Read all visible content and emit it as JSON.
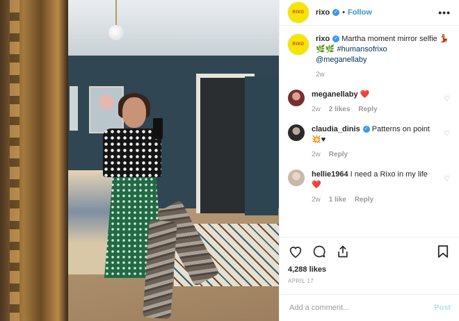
{
  "header": {
    "avatar_text": "RIXO",
    "username": "rixo",
    "verified_mark": "✓",
    "separator": "•",
    "follow_label": "Follow",
    "more_label": "•••"
  },
  "caption": {
    "username": "rixo",
    "text": "Martha moment mirror selfie",
    "emojis": "💃🌿🌿",
    "hashtag": "#humansofrixo",
    "mention": "@meganellaby",
    "time": "2w"
  },
  "comments": [
    {
      "username": "meganellaby",
      "text": "",
      "emoji": "❤️",
      "time": "2w",
      "likes": "2 likes",
      "reply": "Reply",
      "avatar_color": "#7a2f2f"
    },
    {
      "username": "claudia_dinis",
      "text": "Patterns on point",
      "emoji": "💥♥",
      "time": "2w",
      "likes": "",
      "reply": "Reply",
      "avatar_color": "#3a3a3a"
    },
    {
      "username": "hellie1964",
      "text": "I need a Rixo in my life",
      "emoji": "❤️",
      "time": "2w",
      "likes": "1 like",
      "reply": "Reply",
      "avatar_color": "#c9b8a8"
    }
  ],
  "actions": {
    "likes": "4,288 likes",
    "date": "APRIL 17"
  },
  "add_comment": {
    "placeholder": "Add a comment...",
    "post_label": "Post"
  },
  "colors": {
    "brand_yellow": "#f6e500",
    "link_blue": "#3897f0",
    "muted": "#999999"
  }
}
